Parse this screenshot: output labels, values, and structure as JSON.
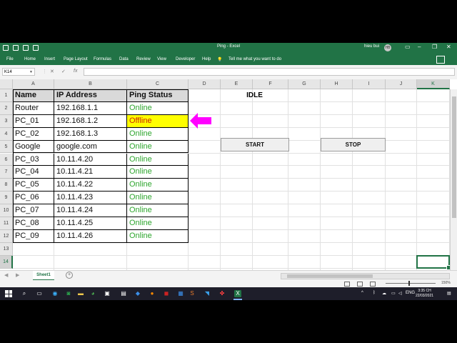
{
  "window": {
    "title": "Ping  -  Excel",
    "user": "hieu bui",
    "avatar": "HB"
  },
  "ribbon": {
    "tabs": [
      "File",
      "Home",
      "Insert",
      "Page Layout",
      "Formulas",
      "Data",
      "Review",
      "View",
      "Developer",
      "Help"
    ],
    "tell_me": "Tell me what you want to do"
  },
  "formula_bar": {
    "name_box": "K14",
    "cancel": "✕",
    "enter": "✓",
    "fx": "fx",
    "value": ""
  },
  "columns": [
    "A",
    "B",
    "C",
    "D",
    "E",
    "F",
    "G",
    "H",
    "I",
    "J",
    "K"
  ],
  "rows": [
    "1",
    "2",
    "3",
    "4",
    "5",
    "6",
    "7",
    "8",
    "9",
    "10",
    "11",
    "12",
    "13",
    "14"
  ],
  "table": {
    "headers": [
      "Name",
      "IP Address",
      "Ping Status"
    ],
    "rows": [
      [
        "Router",
        "192.168.1.1",
        "Online"
      ],
      [
        "PC_01",
        "192.168.1.2",
        "Offline"
      ],
      [
        "PC_02",
        "192.168.1.3",
        "Online"
      ],
      [
        "Google",
        "google.com",
        "Online"
      ],
      [
        "PC_03",
        "10.11.4.20",
        "Online"
      ],
      [
        "PC_04",
        "10.11.4.21",
        "Online"
      ],
      [
        "PC_05",
        "10.11.4.22",
        "Online"
      ],
      [
        "PC_06",
        "10.11.4.23",
        "Online"
      ],
      [
        "PC_07",
        "10.11.4.24",
        "Online"
      ],
      [
        "PC_08",
        "10.11.4.25",
        "Online"
      ],
      [
        "PC_09",
        "10.11.4.26",
        "Online"
      ]
    ]
  },
  "status_label": "IDLE",
  "buttons": {
    "start": "START",
    "stop": "STOP"
  },
  "sheet_tabs": [
    "Sheet1"
  ],
  "zoom": "150%",
  "colors": {
    "excel_green": "#217346",
    "online": "#2ea62e",
    "offline": "#cc2200",
    "highlight": "#ffff00",
    "arrow": "#ff00ff"
  },
  "taskbar": {
    "time": "3:35 CH",
    "date": "22/03/2021",
    "lang": "ENG"
  }
}
